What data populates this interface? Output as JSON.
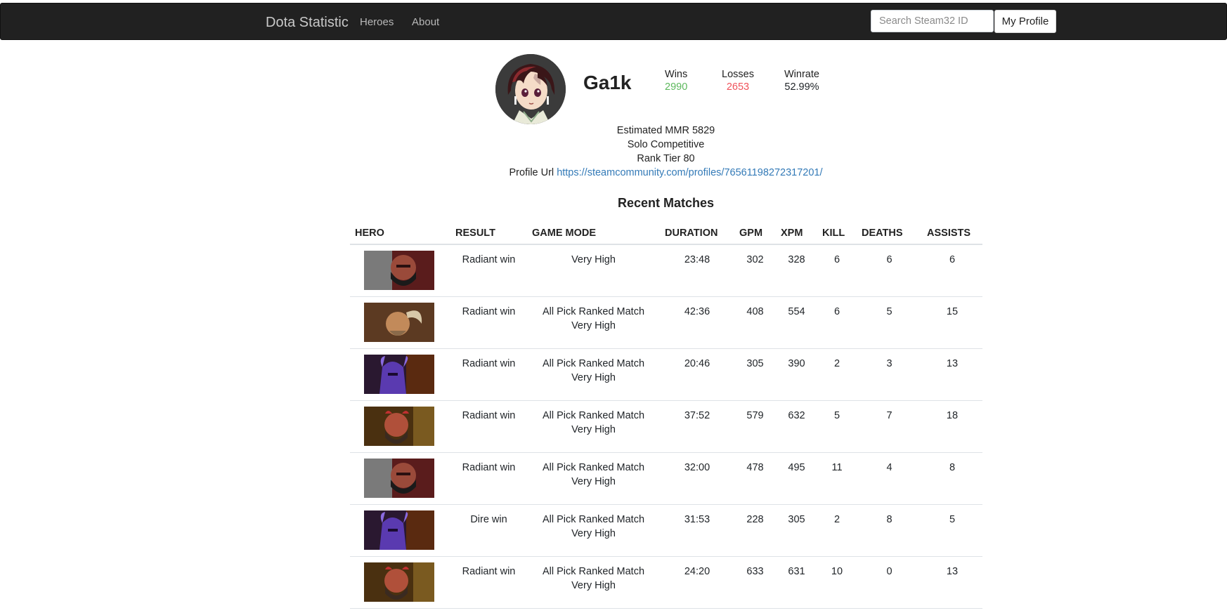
{
  "nav": {
    "brand": "Dota Statistic",
    "links": [
      "Heroes",
      "About"
    ],
    "search_placeholder": "Search Steam32 ID",
    "profile_button": "My Profile"
  },
  "player": {
    "name": "Ga1k",
    "wins_label": "Wins",
    "wins": "2990",
    "losses_label": "Losses",
    "losses": "2653",
    "winrate_label": "Winrate",
    "winrate": "52.99%",
    "mmr_line": "Estimated MMR 5829",
    "competitive_line": "Solo Competitive",
    "rank_line": "Rank Tier 80",
    "profile_url_label": "Profile Url",
    "profile_url": "https://steamcommunity.com/profiles/76561198272317201/"
  },
  "matches": {
    "title": "Recent Matches",
    "columns": [
      "HERO",
      "RESULT",
      "GAME MODE",
      "DURATION",
      "GPM",
      "XPM",
      "KILL",
      "DEATHS",
      "ASSISTS"
    ],
    "rows": [
      {
        "hero": "axe",
        "result": "Radiant win",
        "mode1": "Very High",
        "mode2": "",
        "duration": "23:48",
        "gpm": "302",
        "xpm": "328",
        "kill": "6",
        "deaths": "6",
        "assists": "6"
      },
      {
        "hero": "magnus",
        "result": "Radiant win",
        "mode1": "All Pick Ranked Match",
        "mode2": "Very High",
        "duration": "42:36",
        "gpm": "408",
        "xpm": "554",
        "kill": "6",
        "deaths": "5",
        "assists": "15"
      },
      {
        "hero": "faceless-void",
        "result": "Radiant win",
        "mode1": "All Pick Ranked Match",
        "mode2": "Very High",
        "duration": "20:46",
        "gpm": "305",
        "xpm": "390",
        "kill": "2",
        "deaths": "3",
        "assists": "13"
      },
      {
        "hero": "troll-warlord",
        "result": "Radiant win",
        "mode1": "All Pick Ranked Match",
        "mode2": "Very High",
        "duration": "37:52",
        "gpm": "579",
        "xpm": "632",
        "kill": "5",
        "deaths": "7",
        "assists": "18"
      },
      {
        "hero": "axe",
        "result": "Radiant win",
        "mode1": "All Pick Ranked Match",
        "mode2": "Very High",
        "duration": "32:00",
        "gpm": "478",
        "xpm": "495",
        "kill": "11",
        "deaths": "4",
        "assists": "8"
      },
      {
        "hero": "faceless-void",
        "result": "Dire win",
        "mode1": "All Pick Ranked Match",
        "mode2": "Very High",
        "duration": "31:53",
        "gpm": "228",
        "xpm": "305",
        "kill": "2",
        "deaths": "8",
        "assists": "5"
      },
      {
        "hero": "troll-warlord",
        "result": "Radiant win",
        "mode1": "All Pick Ranked Match",
        "mode2": "Very High",
        "duration": "24:20",
        "gpm": "633",
        "xpm": "631",
        "kill": "10",
        "deaths": "0",
        "assists": "13"
      }
    ]
  }
}
